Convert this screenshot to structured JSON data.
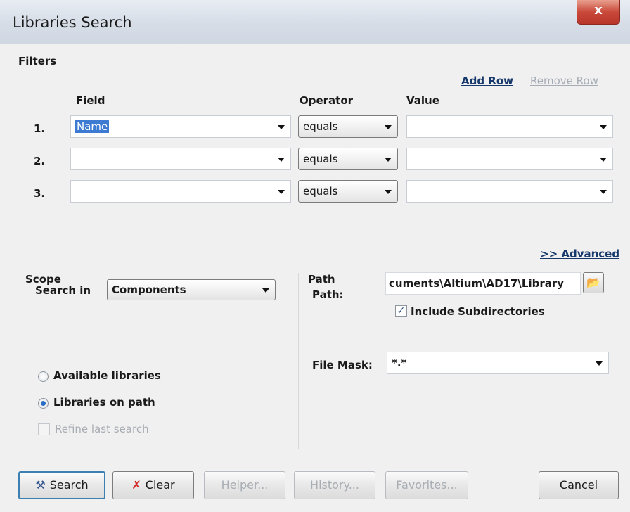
{
  "window": {
    "title": "Libraries Search",
    "close_glyph": "x"
  },
  "filters": {
    "section_label": "Filters",
    "add_row": "Add Row",
    "remove_row": "Remove Row",
    "columns": {
      "field": "Field",
      "operator": "Operator",
      "value": "Value"
    },
    "rows": [
      {
        "num": "1.",
        "field": "Name",
        "operator": "equals",
        "value": ""
      },
      {
        "num": "2.",
        "field": "",
        "operator": "equals",
        "value": ""
      },
      {
        "num": "3.",
        "field": "",
        "operator": "equals",
        "value": ""
      }
    ],
    "advanced": ">> Advanced"
  },
  "scope": {
    "label": "Scope",
    "search_in_label": "Search in",
    "search_in_value": "Components",
    "available_libraries": "Available libraries",
    "libraries_on_path": "Libraries on path",
    "refine_last_search": "Refine last search"
  },
  "path": {
    "label": "Path",
    "path_label": "Path:",
    "path_value": "cuments\\Altium\\AD17\\Library",
    "include_subdirectories": "Include Subdirectories",
    "file_mask_label": "File Mask:",
    "file_mask_value": "*.*"
  },
  "buttons": {
    "search": "Search",
    "clear": "Clear",
    "helper": "Helper...",
    "history": "History...",
    "favorites": "Favorites...",
    "cancel": "Cancel"
  },
  "icons": {
    "search": "tool-icon",
    "clear": "clear-icon",
    "browse": "folder-browse-icon"
  },
  "colors": {
    "selection": "#3d7bd2",
    "close": "#c9493a",
    "link": "#16386b"
  }
}
